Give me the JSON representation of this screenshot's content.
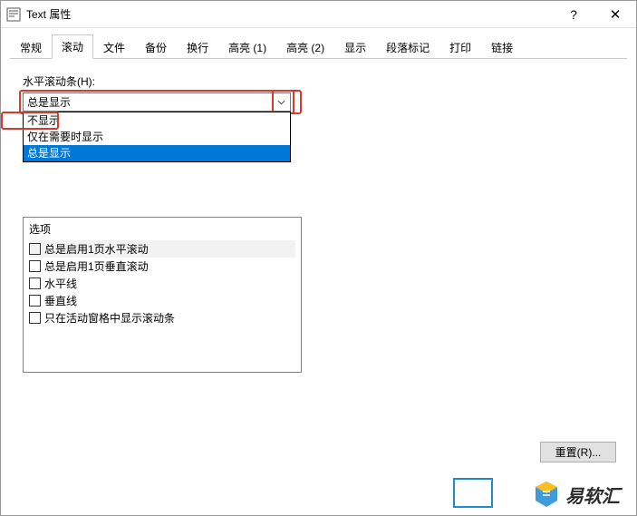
{
  "window": {
    "title": "Text 属性",
    "help_symbol": "?",
    "close_symbol": "✕"
  },
  "tabs": {
    "items": [
      "常规",
      "滚动",
      "文件",
      "备份",
      "换行",
      "高亮 (1)",
      "高亮 (2)",
      "显示",
      "段落标记",
      "打印",
      "链接"
    ],
    "active_index": 1
  },
  "scroll_tab": {
    "field_label": "水平滚动条(H):",
    "selected": "总是显示",
    "options": [
      "不显示",
      "仅在需要时显示",
      "总是显示"
    ],
    "highlighted_index": 2
  },
  "options_box": {
    "title": "选项",
    "items": [
      {
        "label": "总是启用1页水平滚动",
        "checked": false,
        "hl": true
      },
      {
        "label": "总是启用1页垂直滚动",
        "checked": false,
        "hl": false
      },
      {
        "label": "水平线",
        "checked": false,
        "hl": false
      },
      {
        "label": "垂直线",
        "checked": false,
        "hl": false
      },
      {
        "label": "只在活动窗格中显示滚动条",
        "checked": false,
        "hl": false
      }
    ]
  },
  "buttons": {
    "reset": "重置(R)..."
  },
  "watermark": {
    "brand": "易软汇"
  },
  "annotations": {
    "combo_red_box": true,
    "option_red_box_index": 0
  }
}
